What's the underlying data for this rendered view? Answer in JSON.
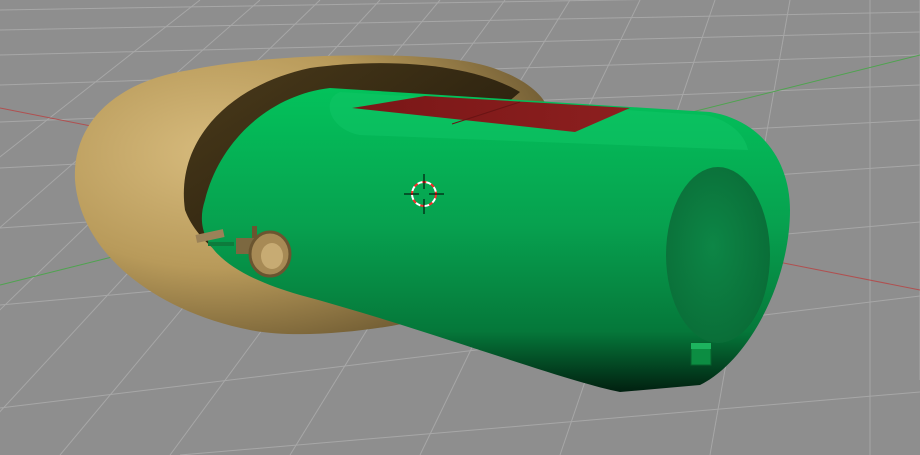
{
  "viewport": {
    "background_color": "#8e8e8e",
    "grid_color": "#a7a7a7",
    "x_axis_color": "#b05050",
    "y_axis_color": "#4fa34f"
  },
  "scene": {
    "shell_color": "#b89a5a",
    "tank_color": "#07a14f",
    "tank_end_color": "#0b7b3f",
    "hatch_color": "#8c1f1f",
    "fitting_color": "#9b8258",
    "small_block_color": "#0c8d42"
  },
  "cursor": {
    "type": "3d-cursor-icon",
    "colors": [
      "#ff0000",
      "#ffffff"
    ]
  }
}
